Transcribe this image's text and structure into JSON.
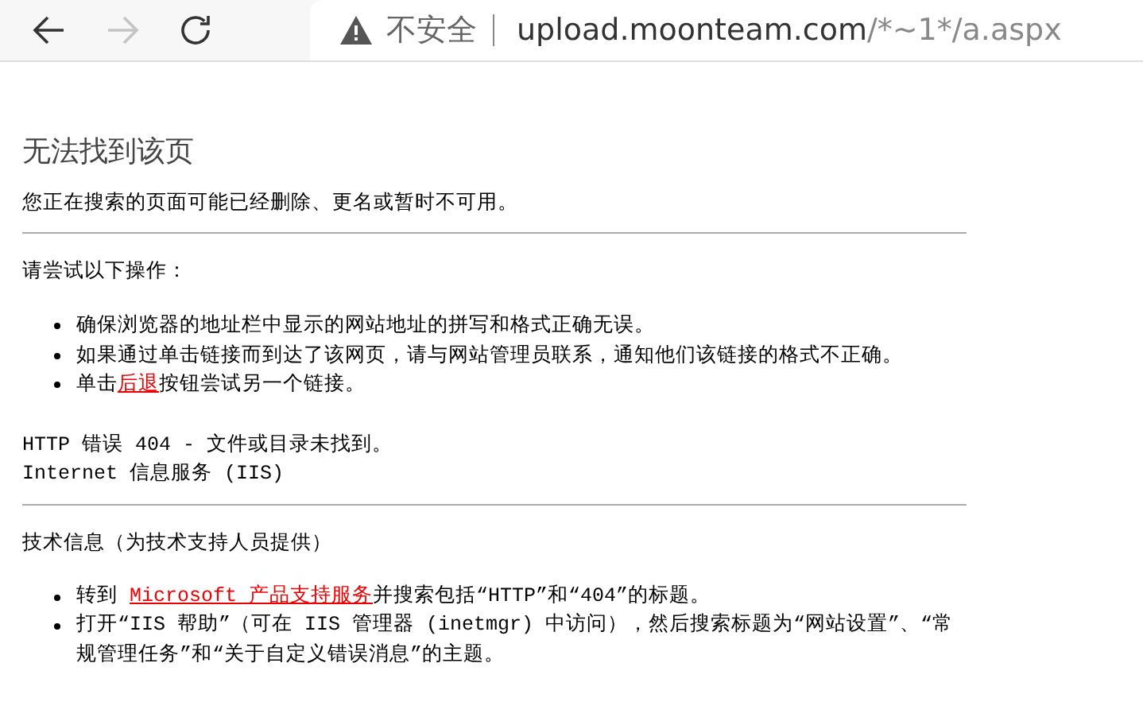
{
  "toolbar": {
    "back_disabled": false,
    "forward_disabled": true,
    "security_label": "不安全",
    "url_host": "upload.moonteam.com",
    "url_path": "/*~1*/a.aspx"
  },
  "page": {
    "title": "无法找到该页",
    "intro": "您正在搜索的页面可能已经删除、更名或暂时不可用。",
    "try_heading": "请尝试以下操作：",
    "try_items": [
      {
        "before": "确保浏览器的地址栏中显示的网站地址的拼写和格式正确无误。"
      },
      {
        "before": "如果通过单击链接而到达了该网页，请与网站管理员联系，通知他们该链接的格式不正确。"
      },
      {
        "before": "单击",
        "link": "后退",
        "after": "按钮尝试另一个链接。"
      }
    ],
    "error_lines": [
      "HTTP 错误 404 - 文件或目录未找到。",
      "Internet 信息服务 (IIS)"
    ],
    "tech_heading": "技术信息（为技术支持人员提供）",
    "tech_items": [
      {
        "before": "转到 ",
        "link": "Microsoft 产品支持服务",
        "after": "并搜索包括“HTTP”和“404”的标题。"
      },
      {
        "before": "打开“IIS 帮助”（可在 IIS 管理器 (inetmgr) 中访问），然后搜索标题为“网站设置”、“常规管理任务”和“关于自定义错误消息”的主题。"
      }
    ]
  }
}
